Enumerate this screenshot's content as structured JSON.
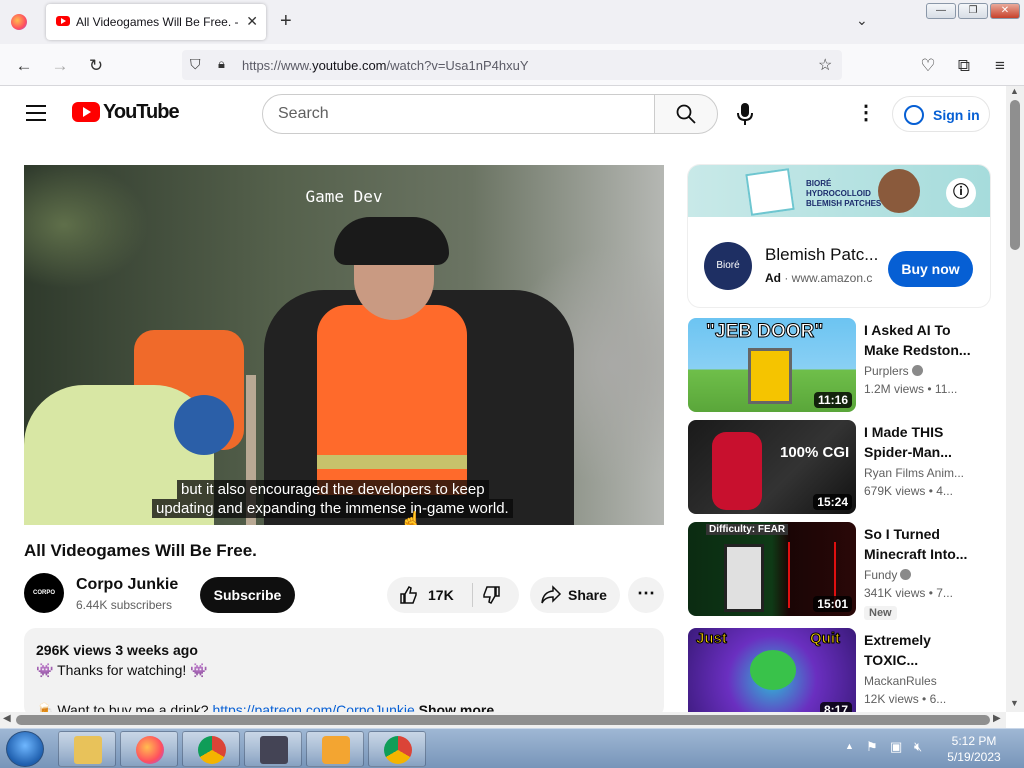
{
  "browser": {
    "tab_title": "All Videogames Will Be Free. - Y",
    "url_prefix": "https://www.",
    "url_domain": "youtube.com",
    "url_path": "/watch?v=Usa1nP4hxuY"
  },
  "youtube": {
    "wordmark": "YouTube",
    "search_placeholder": "Search",
    "signin_label": "Sign in"
  },
  "video": {
    "overlay_title": "Game Dev",
    "caption_line1": "but it also encouraged the developers to keep",
    "caption_line2": "updating and expanding the immense in-game world.",
    "title": "All Videogames Will Be Free.",
    "channel_avatar_text": "CORPO",
    "channel_name": "Corpo Junkie",
    "subscribers": "6.44K subscribers",
    "subscribe_label": "Subscribe",
    "likes": "17K",
    "share_label": "Share"
  },
  "description": {
    "stats": "296K views  3 weeks ago",
    "line1": "👾 Thanks for watching! 👾",
    "line2_prefix": "🍺 Want to buy me a drink? ",
    "line2_link": "https://patreon.com/CorpoJunkie",
    "show_more": "Show more"
  },
  "ad": {
    "banner_text_line1": "BIORÉ",
    "banner_text_line2": "HYDROCOLLOID",
    "banner_text_line3": "BLEMISH PATCHES",
    "logo_text": "Bioré",
    "title": "Blemish Patc...",
    "label": "Ad",
    "domain": "www.amazon.c",
    "cta": "Buy now"
  },
  "recommendations": [
    {
      "title": "I Asked AI To Make Redston...",
      "channel": "Purplers",
      "verified": true,
      "views": "1.2M views",
      "age": "11...",
      "duration": "11:16",
      "thumb_text": "\"JEB DOOR\""
    },
    {
      "title": "I Made THIS Spider-Man...",
      "channel": "Ryan Films Anim...",
      "verified": false,
      "views": "679K views",
      "age": "4...",
      "duration": "15:24",
      "thumb_text": "100% CGI"
    },
    {
      "title": "So I Turned Minecraft Into...",
      "channel": "Fundy",
      "verified": true,
      "views": "341K views",
      "age": "7...",
      "duration": "15:01",
      "thumb_text": "Difficulty: FEAR",
      "badge": "New"
    },
    {
      "title": "Extremely TOXIC...",
      "channel": "MackanRules",
      "verified": false,
      "views": "12K views",
      "age": "6...",
      "duration": "8:17",
      "thumb_text_left": "Just",
      "thumb_text_right": "Quit"
    }
  ],
  "taskbar": {
    "time": "5:12 PM",
    "date": "5/19/2023"
  },
  "colors": {
    "yt_red": "#ff0000",
    "link_blue": "#065fd4",
    "vest_orange": "#ff6a2b"
  }
}
